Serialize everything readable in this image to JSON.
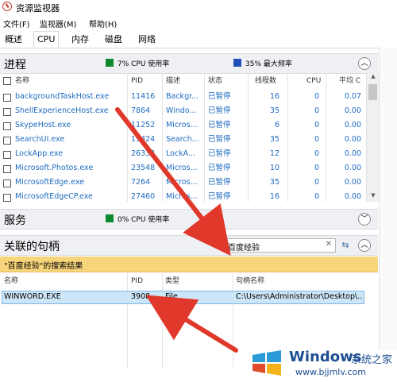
{
  "window": {
    "title": "资源监视器"
  },
  "menu": [
    "文件(F)",
    "监视器(M)",
    "帮助(H)"
  ],
  "tabs": [
    "概述",
    "CPU",
    "内存",
    "磁盘",
    "网络"
  ],
  "process_section": {
    "title": "进程",
    "cpu_usage": "7% CPU 使用率",
    "max_freq": "35% 最大频率",
    "columns": [
      "名称",
      "PID",
      "描述",
      "状态",
      "线程数",
      "CPU",
      "平均 C"
    ],
    "rows": [
      [
        "backgroundTaskHost.exe",
        "11416",
        "Backgr...",
        "已暂停",
        "16",
        "0",
        "0.07"
      ],
      [
        "ShellExperienceHost.exe",
        "7864",
        "Windo...",
        "已暂停",
        "35",
        "0",
        "0.00"
      ],
      [
        "SkypeHost.exe",
        "11252",
        "Micros...",
        "已暂停",
        "6",
        "0",
        "0.00"
      ],
      [
        "SearchUI.exe",
        "19424",
        "Search...",
        "已暂停",
        "35",
        "0",
        "0.00"
      ],
      [
        "LockApp.exe",
        "26332",
        "LockA...",
        "已暂停",
        "12",
        "0",
        "0.00"
      ],
      [
        "Microsoft.Photos.exe",
        "23548",
        "Micros...",
        "已暂停",
        "10",
        "0",
        "0.00"
      ],
      [
        "MicrosoftEdge.exe",
        "7264",
        "Micros...",
        "已暂停",
        "35",
        "0",
        "0.00"
      ],
      [
        "MicrosoftEdgeCP.exe",
        "27460",
        "Micros...",
        "已暂停",
        "16",
        "0",
        "0.00"
      ]
    ]
  },
  "services_section": {
    "title": "服务",
    "cpu_usage": "0% CPU 使用率"
  },
  "handles_section": {
    "title": "关联的句柄",
    "search_value": "百度经验",
    "search_clear": "✕",
    "banner": "\"百度经验\"的搜索结果",
    "columns": [
      "名称",
      "PID",
      "类型",
      "句柄名称"
    ],
    "rows": [
      [
        "WINWORD.EXE",
        "3908",
        "File",
        "C:\\Users\\Administrator\\Desktop\\..."
      ]
    ]
  },
  "watermark": {
    "brand": "Windows",
    "brand_cn": "系统之家",
    "url": "www.bjjmlv.com"
  },
  "colors": {
    "legend_green": "#0e8a2e",
    "legend_blue": "#1f4fb8",
    "link_blue": "#1e6bc0",
    "banner": "#f7d57a",
    "arrow_red": "#e0392b"
  }
}
